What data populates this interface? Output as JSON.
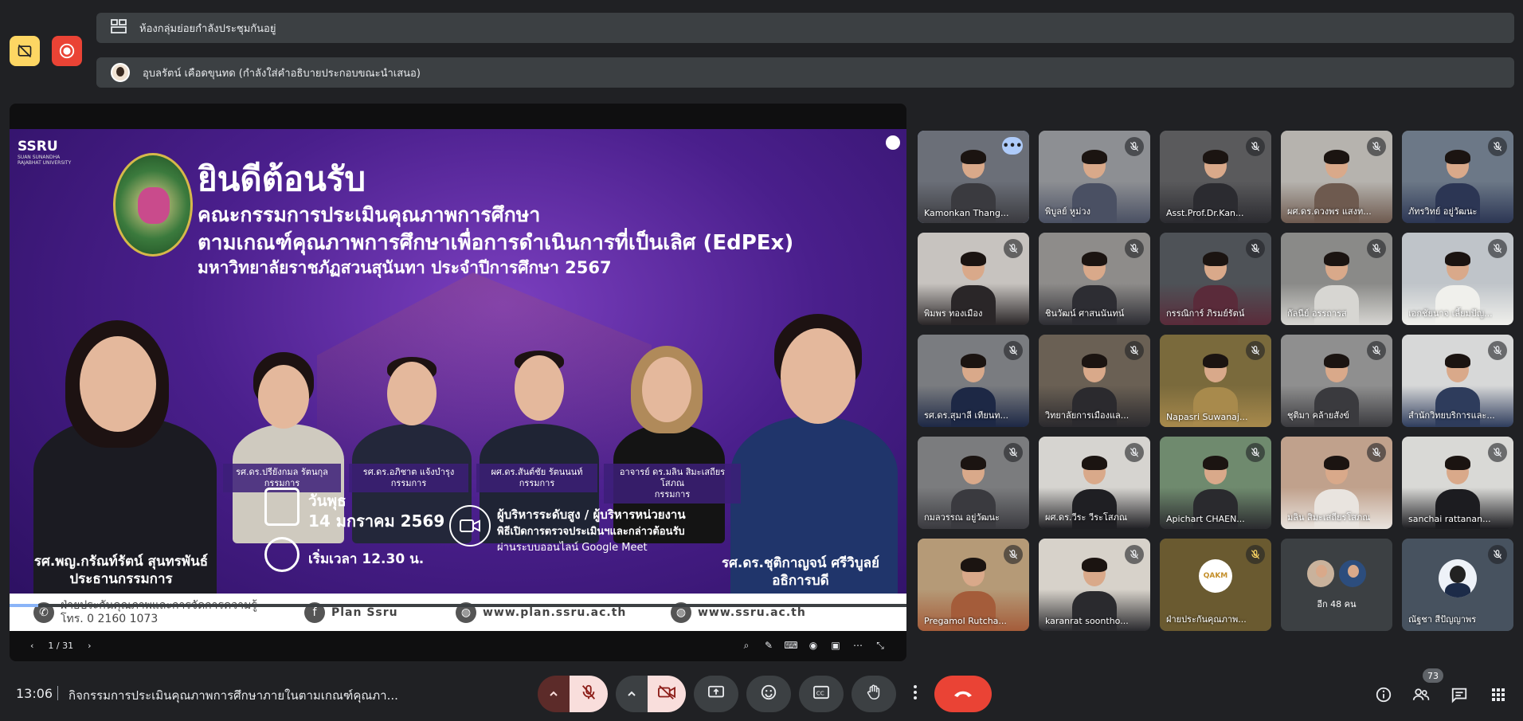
{
  "banners": {
    "breakout": "ห้องกลุ่มย่อยกำลังประชุมกันอยู่",
    "captions": "อุบลรัตน์ เคือดขุนทด (กำลังใส่คำอธิบายประกอบขณะนำเสนอ)"
  },
  "slide": {
    "logo": "SSRU",
    "logo_small": "SUAN SUNANDHA RAJABHAT UNIVERSITY",
    "title": "ยินดีต้อนรับ",
    "subtitle1": "คณะกรรมการประเมินคุณภาพการศึกษา",
    "subtitle2": "ตามเกณฑ์คุณภาพการศึกษาเพื่อการดำเนินการที่เป็นเลิศ (EdPEx)",
    "subtitle3": "มหาวิทยาลัยราชภัฏสวนสุนันทา ประจำปีการศึกษา 2567",
    "committee": [
      {
        "name": "รศ.ดร.ปรียังกมล รัตนกุล",
        "role": "กรรมการ"
      },
      {
        "name": "รศ.ดร.อภิชาต แจ้งบำรุง",
        "role": "กรรมการ"
      },
      {
        "name": "ผศ.ดร.สันต์ชัย รัตนนนท์",
        "role": "กรรมการ"
      },
      {
        "name": "อาจารย์ ดร.มลิน สิมะเสถียรโสภณ",
        "role": "กรรมการ"
      }
    ],
    "chair_name": "รศ.พญ.กรัณท์รัตน์ สุนทรพันธ์",
    "chair_role": "ประธานกรรมการ",
    "president_name": "รศ.ดร.ชุติกาญจน์ ศรีวิบูลย์",
    "president_role": "อธิการบดี",
    "day": "วันพุธ",
    "date": "14 มกราคม 2569",
    "time": "เริ่มเวลา 12.30 น.",
    "exec1": "ผู้บริหารระดับสูง / ผู้บริหารหน่วยงาน",
    "exec2": "พิธีเปิดการตรวจประเมินฯและกล่าวต้อนรับ",
    "exec3": "ผ่านระบบออนไลน์ Google Meet",
    "footer": {
      "dept": "ฝ่ายประกันคุณภาพและการจัดการความรู้",
      "phone": "โทร. 0 2160 1073",
      "facebook": "Plan Ssru",
      "web1": "www.plan.ssru.ac.th",
      "web2": "www.ssru.ac.th"
    },
    "page_indicator": "1 / 31"
  },
  "participants": [
    {
      "name": "Kamonkan Thang...",
      "active": true
    },
    {
      "name": "พิบูลย์ หูม่วง"
    },
    {
      "name": "Asst.Prof.Dr.Kan..."
    },
    {
      "name": "ผศ.ดร.ดวงพร แสงท..."
    },
    {
      "name": "ภัทรวิทย์ อยู่วัฒนะ"
    },
    {
      "name": "พิมพร ทองเมือง"
    },
    {
      "name": "ชินวัฒน์ ศาสนนันทน์"
    },
    {
      "name": "กรรณิการ์ ภิรมย์รัตน์"
    },
    {
      "name": "กัลนีย์ อรรถารส"
    },
    {
      "name": "เอกชัยนาจ เลี้ยมปัญ..."
    },
    {
      "name": "รศ.ดร.สุมาลี เทียนท..."
    },
    {
      "name": "วิทยาลัยการเมืองแล..."
    },
    {
      "name": "Napasri Suwanaj..."
    },
    {
      "name": "ชุติมา คล้ายสังข์"
    },
    {
      "name": "สำนักวิทยบริการและ..."
    },
    {
      "name": "กมลวรรณ อยู่วัฒนะ"
    },
    {
      "name": "ผศ.ดร.วีระ วีระโสภณ"
    },
    {
      "name": "Apichart CHAEN..."
    },
    {
      "name": "มลิน สิมะเสถียรโสภณ"
    },
    {
      "name": "sanchai rattanan..."
    },
    {
      "name": "Pregamol Rutcha..."
    },
    {
      "name": "karanrat soontho..."
    },
    {
      "name": "ฝ่ายประกันคุณภาพ...",
      "logo": "QAKM"
    },
    {
      "name": "อีก 48 คน"
    },
    {
      "name": "ณัฐชา สีปัญญาพร"
    }
  ],
  "bottom": {
    "time": "13:06",
    "meeting_title": "กิจกรรมการประเมินคุณภาพการศึกษาภายในตามเกณฑ์คุณภา...",
    "people_count": "73"
  },
  "colors": {
    "bg": "#202124",
    "banner": "#3c4043",
    "end_call": "#ea4335",
    "muted_btn": "#f9dedc",
    "accent": "#8ab4f8"
  }
}
